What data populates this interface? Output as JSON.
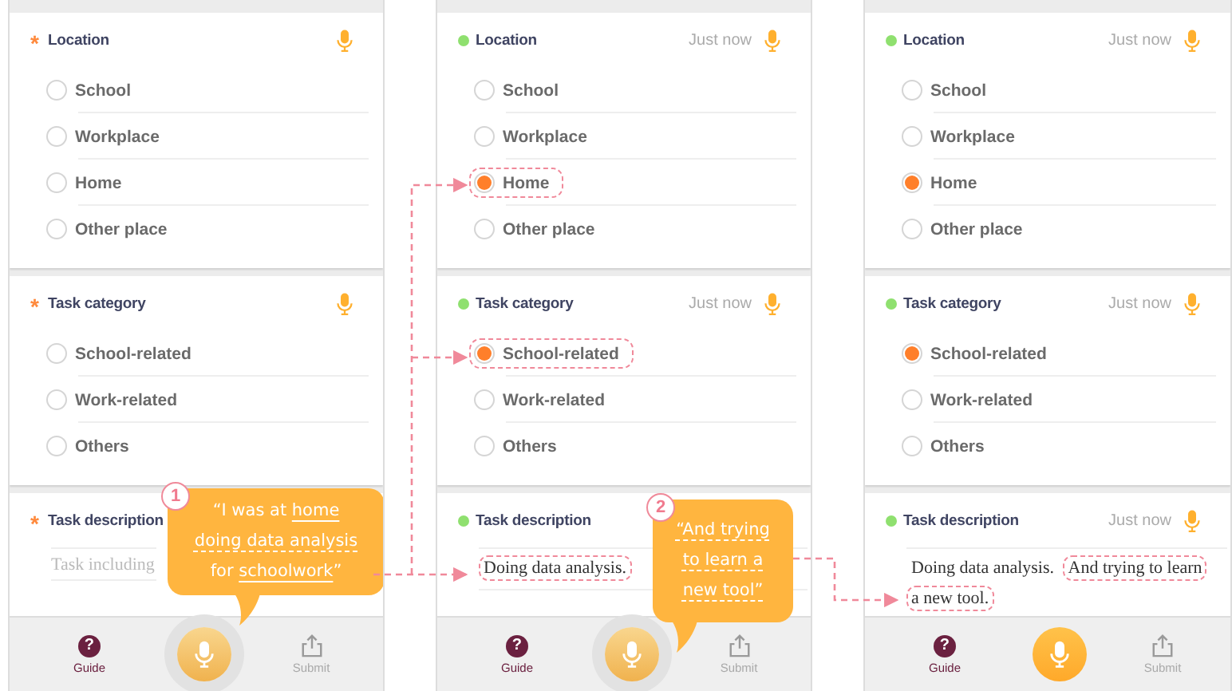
{
  "screens": [
    {
      "questions": [
        {
          "kind": "choice",
          "title": "Location",
          "answered": false,
          "mark": "*",
          "options": [
            {
              "label": "School",
              "selected": false,
              "highlighted": false
            },
            {
              "label": "Workplace",
              "selected": false,
              "highlighted": false
            },
            {
              "label": "Home",
              "selected": false,
              "highlighted": false
            },
            {
              "label": "Other place",
              "selected": false,
              "highlighted": false
            }
          ]
        },
        {
          "kind": "choice",
          "title": "Task category",
          "answered": false,
          "mark": "*",
          "options": [
            {
              "label": "School-related",
              "selected": false,
              "highlighted": false
            },
            {
              "label": "Work-related",
              "selected": false,
              "highlighted": false
            },
            {
              "label": "Others",
              "selected": false,
              "highlighted": false
            }
          ]
        },
        {
          "kind": "text",
          "title": "Task description",
          "answered": false,
          "mark": "*",
          "placeholder": "Task including"
        }
      ],
      "bottom_bar": {
        "guide": {
          "icon": "?",
          "label": "Guide"
        },
        "recording": true,
        "submit": {
          "label": "Submit"
        }
      },
      "callout": {
        "number": "1",
        "lines": [
          [
            {
              "text": "“I was at ",
              "underlined": false
            },
            {
              "text": "home",
              "underlined": true,
              "dashed": false
            }
          ],
          [
            {
              "text": "doing data analysis",
              "underlined": true,
              "dashed": true
            }
          ],
          [
            {
              "text": "for ",
              "underlined": false
            },
            {
              "text": "schoolwork",
              "underlined": true,
              "dashed": false
            },
            {
              "text": "”",
              "underlined": false
            }
          ]
        ]
      }
    },
    {
      "questions": [
        {
          "kind": "choice",
          "title": "Location",
          "answered": true,
          "timestamp": "Just now",
          "options": [
            {
              "label": "School",
              "selected": false,
              "highlighted": false
            },
            {
              "label": "Workplace",
              "selected": false,
              "highlighted": false
            },
            {
              "label": "Home",
              "selected": true,
              "highlighted": true
            },
            {
              "label": "Other place",
              "selected": false,
              "highlighted": false
            }
          ]
        },
        {
          "kind": "choice",
          "title": "Task category",
          "answered": true,
          "timestamp": "Just now",
          "options": [
            {
              "label": "School-related",
              "selected": true,
              "highlighted": true
            },
            {
              "label": "Work-related",
              "selected": false,
              "highlighted": false
            },
            {
              "label": "Others",
              "selected": false,
              "highlighted": false
            }
          ]
        },
        {
          "kind": "text",
          "title": "Task description",
          "answered": true,
          "value": [
            {
              "text": "Doing data analysis.",
              "highlighted": true
            }
          ]
        }
      ],
      "bottom_bar": {
        "guide": {
          "icon": "?",
          "label": "Guide"
        },
        "recording": true,
        "submit": {
          "label": "Submit"
        }
      },
      "callout": {
        "number": "2",
        "lines": [
          [
            {
              "text": "“And trying",
              "underlined": true,
              "dashed": true
            }
          ],
          [
            {
              "text": "to learn a",
              "underlined": true,
              "dashed": true
            }
          ],
          [
            {
              "text": "new tool”",
              "underlined": true,
              "dashed": true
            }
          ]
        ]
      }
    },
    {
      "questions": [
        {
          "kind": "choice",
          "title": "Location",
          "answered": true,
          "timestamp": "Just now",
          "options": [
            {
              "label": "School",
              "selected": false,
              "highlighted": false
            },
            {
              "label": "Workplace",
              "selected": false,
              "highlighted": false
            },
            {
              "label": "Home",
              "selected": true,
              "highlighted": false
            },
            {
              "label": "Other place",
              "selected": false,
              "highlighted": false
            }
          ]
        },
        {
          "kind": "choice",
          "title": "Task category",
          "answered": true,
          "timestamp": "Just now",
          "options": [
            {
              "label": "School-related",
              "selected": true,
              "highlighted": false
            },
            {
              "label": "Work-related",
              "selected": false,
              "highlighted": false
            },
            {
              "label": "Others",
              "selected": false,
              "highlighted": false
            }
          ]
        },
        {
          "kind": "text",
          "title": "Task description",
          "answered": true,
          "timestamp": "Just now",
          "value": [
            {
              "text": "Doing data analysis.",
              "highlighted": false
            },
            {
              "text": "And trying to learn",
              "highlighted": true
            },
            {
              "text": "a new tool.",
              "highlighted": true
            }
          ]
        }
      ],
      "bottom_bar": {
        "guide": {
          "icon": "?",
          "label": "Guide"
        },
        "recording": false,
        "submit": {
          "label": "Submit"
        }
      }
    }
  ]
}
